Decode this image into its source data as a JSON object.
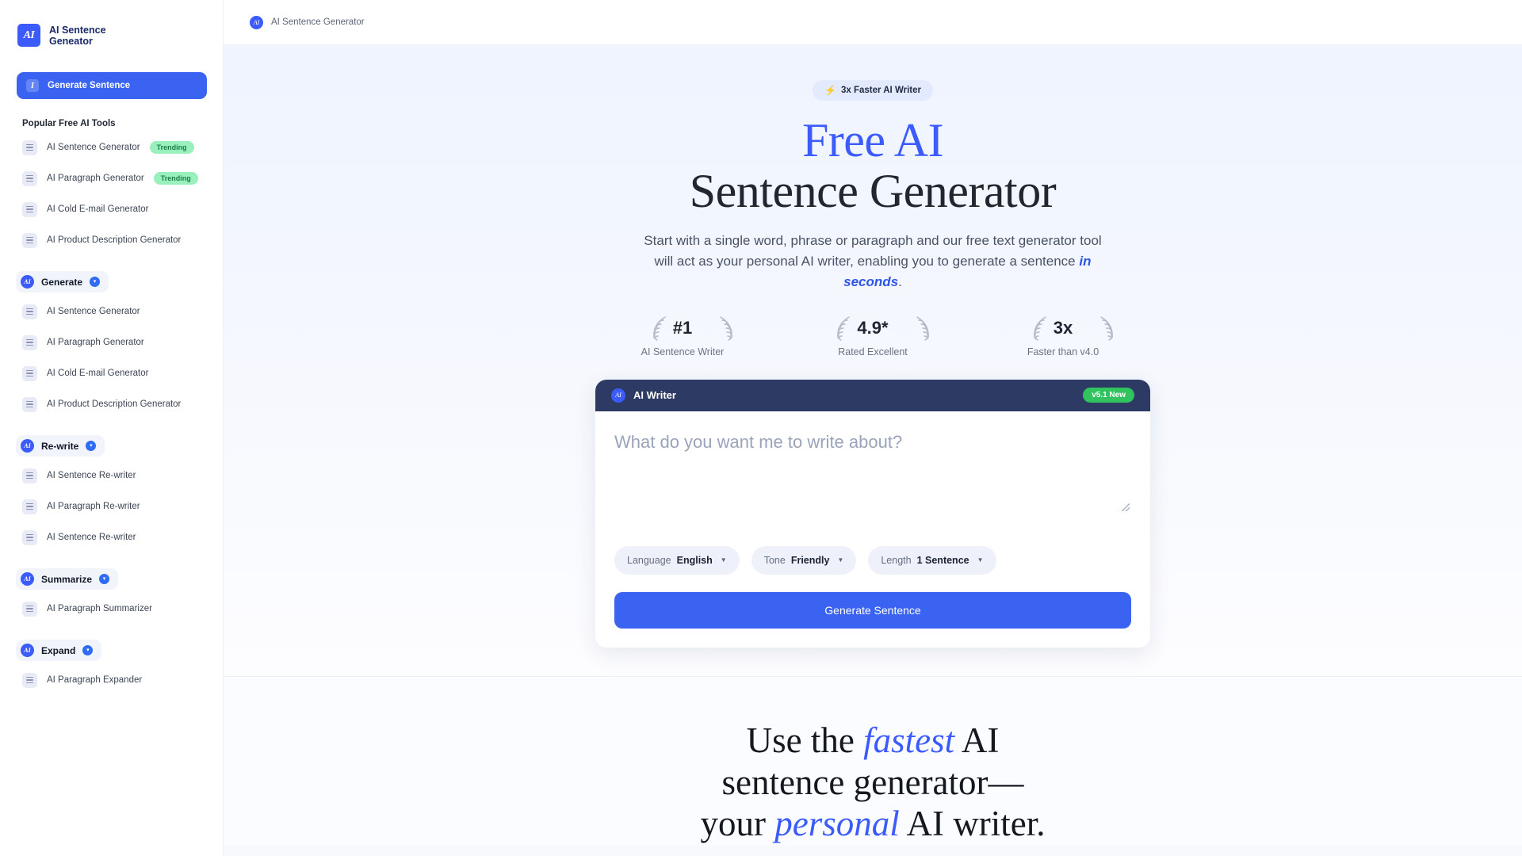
{
  "brand": {
    "logo_text": "AI",
    "name_line1": "AI Sentence",
    "name_line2": "Geneator"
  },
  "sidebar": {
    "cta": {
      "icon": "italic-i-icon",
      "label": "Generate Sentence"
    },
    "section_title": "Popular Free AI Tools",
    "popular_items": [
      {
        "label": "AI Sentence Generator",
        "badge": "Trending"
      },
      {
        "label": "AI Paragraph Generator",
        "badge": "Trending"
      },
      {
        "label": "AI Cold E-mail Generator",
        "badge": ""
      },
      {
        "label": "AI Product Description Generator",
        "badge": ""
      }
    ],
    "groups": [
      {
        "label": "Generate",
        "icon": "ai-circle-icon",
        "chevron": "chevron-down-icon",
        "items": [
          {
            "label": "AI Sentence Generator"
          },
          {
            "label": "AI Paragraph Generator"
          },
          {
            "label": "AI Cold E-mail Generator"
          },
          {
            "label": "AI Product Description Generator"
          }
        ]
      },
      {
        "label": "Re-write",
        "icon": "ai-circle-icon",
        "chevron": "chevron-down-icon",
        "items": [
          {
            "label": "AI Sentence Re-writer"
          },
          {
            "label": "AI Paragraph Re-writer"
          },
          {
            "label": "AI Sentence Re-writer"
          }
        ]
      },
      {
        "label": "Summarize",
        "icon": "ai-circle-icon",
        "chevron": "chevron-down-icon",
        "items": [
          {
            "label": "AI Paragraph Summarizer"
          }
        ]
      },
      {
        "label": "Expand",
        "icon": "ai-circle-icon",
        "chevron": "chevron-down-icon",
        "items": [
          {
            "label": "AI Paragraph Expander"
          }
        ]
      }
    ]
  },
  "topbar": {
    "icon": "ai-circle-icon",
    "title": "AI Sentence Generator"
  },
  "hero": {
    "badge_icon": "lightning-bolt-icon",
    "badge": "3x Faster AI Writer",
    "title_line1_blue": "Free AI",
    "title_line2": "Sentence Generator",
    "paragraph_part1": "Start with a single word, phrase or paragraph and our free text generator tool will act as your personal AI writer, enabling you to generate a sentence ",
    "paragraph_emphasis": "in seconds",
    "paragraph_part2": ".",
    "stats": [
      {
        "value": "#1",
        "label": "AI Sentence Writer"
      },
      {
        "value": "4.9*",
        "label": "Rated Excellent"
      },
      {
        "value": "3x",
        "label": "Faster than v4.0"
      }
    ]
  },
  "writer_card": {
    "header_icon": "ai-circle-icon",
    "header_title": "AI Writer",
    "version_badge": "v5.1 New",
    "textarea_value": "",
    "textarea_placeholder": "What do you want me to write about?",
    "controls": [
      {
        "key": "Language",
        "value": "English",
        "arrow": "chevron-down-icon"
      },
      {
        "key": "Tone",
        "value": "Friendly",
        "arrow": "chevron-down-icon"
      },
      {
        "key": "Length",
        "value": "1 Sentence",
        "arrow": "chevron-down-icon"
      }
    ],
    "generate_button": "Generate Sentence"
  },
  "band": {
    "line1_a": "Use the ",
    "line1_em": "fastest",
    "line1_b": " AI",
    "line2": "sentence generator—",
    "line3_a": "your ",
    "line3_em": "personal",
    "line3_b": " AI writer."
  },
  "colors": {
    "brand_blue": "#3b5bfd",
    "cta_blue": "#3b63f2",
    "card_header": "#2d3a63",
    "badge_green": "#31c45e",
    "trending_green": "#9af0bd"
  }
}
